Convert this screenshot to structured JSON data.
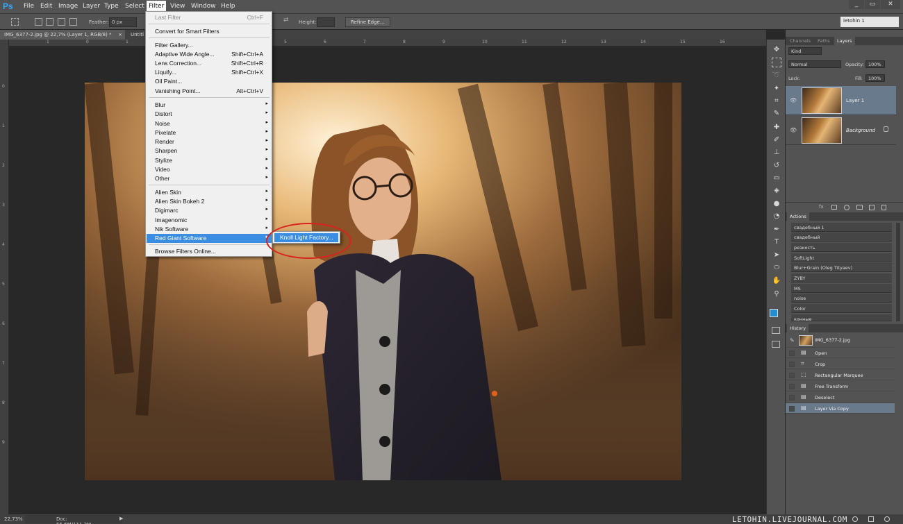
{
  "app": {
    "logo": "Ps",
    "workspace": "letohin 1"
  },
  "menubar": [
    "File",
    "Edit",
    "Image",
    "Layer",
    "Type",
    "Select",
    "Filter",
    "View",
    "Window",
    "Help"
  ],
  "window_controls": [
    "_",
    "▭",
    "✕"
  ],
  "options": {
    "feather_label": "Feather:",
    "feather_value": "0 px",
    "height_label": "Height:",
    "refine_edge": "Refine Edge..."
  },
  "tabs": [
    "IMG_6377-2.jpg @ 22,7% (Layer 1, RGB/8) *",
    "Untitl"
  ],
  "tab_close": "×",
  "ruler_top": [
    "1",
    "0",
    "1",
    "2",
    "3",
    "4",
    "5",
    "6",
    "7",
    "8",
    "9",
    "10",
    "11",
    "12",
    "13",
    "14",
    "15",
    "16"
  ],
  "ruler_left": [
    "0",
    "1",
    "2",
    "3",
    "4",
    "5",
    "6",
    "7",
    "8",
    "9"
  ],
  "filter_menu": {
    "items": [
      {
        "label": "Last Filter",
        "shortcut": "Ctrl+F",
        "disabled": true
      },
      {
        "label": "Convert for Smart Filters"
      },
      {
        "label": "Filter Gallery..."
      },
      {
        "label": "Adaptive Wide Angle...",
        "shortcut": "Shift+Ctrl+A"
      },
      {
        "label": "Lens Correction...",
        "shortcut": "Shift+Ctrl+R"
      },
      {
        "label": "Liquify...",
        "shortcut": "Shift+Ctrl+X"
      },
      {
        "label": "Oil Paint..."
      },
      {
        "label": "Vanishing Point...",
        "shortcut": "Alt+Ctrl+V"
      },
      {
        "label": "Blur",
        "submenu": true
      },
      {
        "label": "Distort",
        "submenu": true
      },
      {
        "label": "Noise",
        "submenu": true
      },
      {
        "label": "Pixelate",
        "submenu": true
      },
      {
        "label": "Render",
        "submenu": true
      },
      {
        "label": "Sharpen",
        "submenu": true
      },
      {
        "label": "Stylize",
        "submenu": true
      },
      {
        "label": "Video",
        "submenu": true
      },
      {
        "label": "Other",
        "submenu": true
      },
      {
        "label": "Alien Skin",
        "submenu": true
      },
      {
        "label": "Alien Skin Bokeh 2",
        "submenu": true
      },
      {
        "label": "Digimarc",
        "submenu": true
      },
      {
        "label": "Imagenomic",
        "submenu": true
      },
      {
        "label": "Nik Software",
        "submenu": true
      },
      {
        "label": "Red Giant Software",
        "submenu": true,
        "highlighted": true
      },
      {
        "label": "Browse Filters Online..."
      }
    ],
    "submenu_item": "Knoll Light Factory...",
    "submenu_arrow": "▸"
  },
  "layers_panel": {
    "tabs": [
      "Channels",
      "Paths",
      "Layers"
    ],
    "kind": "Kind",
    "blend_mode": "Normal",
    "opacity_label": "Opacity:",
    "opacity": "100%",
    "lock_label": "Lock:",
    "fill_label": "Fill:",
    "fill": "100%",
    "layers": [
      {
        "name": "Layer 1",
        "selected": true
      },
      {
        "name": "Background",
        "selected": false,
        "locked": true
      }
    ]
  },
  "actions_panel": {
    "title": "Actions",
    "items": [
      "свадебный 1",
      "свадебный",
      "резкость",
      "SoftLight",
      "Blur+Grain (Oleg Tityaev)",
      "ZYBY",
      "MS",
      "noise",
      "Color",
      "конные"
    ]
  },
  "history_panel": {
    "title": "History",
    "snapshot": "IMG_6377-2.jpg",
    "steps": [
      "Open",
      "Crop",
      "Rectangular Marquee",
      "Free Transform",
      "Deselect",
      "Layer Via Copy"
    ]
  },
  "status": {
    "zoom": "22,73%",
    "doc": "Doc: 55,6M/111,2M",
    "arrow": "▶"
  },
  "watermark": "LETOHIN.LIVEJOURNAL.COM",
  "tool_icons": [
    "move-icon",
    "marquee-icon",
    "lasso-icon",
    "magic-wand-icon",
    "crop-icon",
    "eyedropper-icon",
    "healing-brush-icon",
    "brush-icon",
    "clone-stamp-icon",
    "history-brush-icon",
    "eraser-icon",
    "paint-bucket-icon",
    "blur-tool-icon",
    "dodge-icon",
    "pen-icon",
    "type-icon",
    "path-selection-icon",
    "shape-icon",
    "hand-icon",
    "zoom-icon"
  ],
  "colors": {
    "accent": "#3a8de0",
    "annotation": "#d8231e",
    "panel": "#535353",
    "canvas": "#282828",
    "foreground": "#1e8fd0"
  }
}
